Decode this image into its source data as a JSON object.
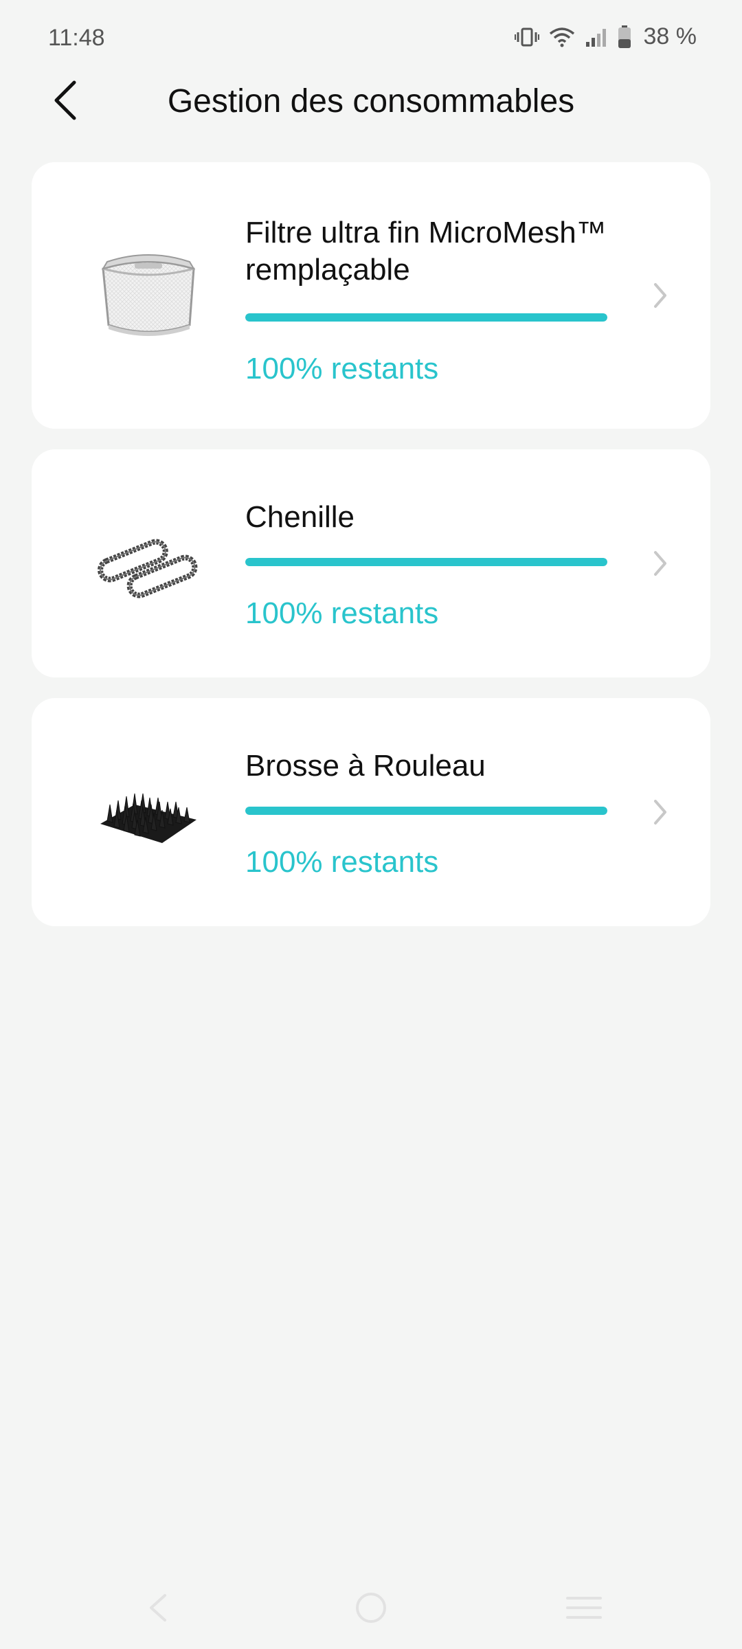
{
  "status_bar": {
    "time": "11:48",
    "battery": "38 %",
    "icons": [
      "vibrate-icon",
      "wifi-icon",
      "signal-icon",
      "battery-icon"
    ]
  },
  "header": {
    "title": "Gestion des consommables",
    "back_icon": "back-arrow-icon"
  },
  "consumables": [
    {
      "title": "Filtre ultra fin MicroMesh™ remplaçable",
      "status": "100% restants",
      "remaining": 1.0,
      "image": "filter-image"
    },
    {
      "title": "Chenille",
      "status": "100% restants",
      "remaining": 1.0,
      "image": "track-belt-image"
    },
    {
      "title": "Brosse à Rouleau",
      "status": "100% restants",
      "remaining": 1.0,
      "image": "roller-brush-image"
    }
  ],
  "colors": {
    "accent": "#29c4cc",
    "background": "#f4f5f4",
    "card": "#ffffff"
  },
  "nav_bar": {
    "icons": [
      "nav-back-icon",
      "nav-home-icon",
      "nav-menu-icon"
    ]
  }
}
